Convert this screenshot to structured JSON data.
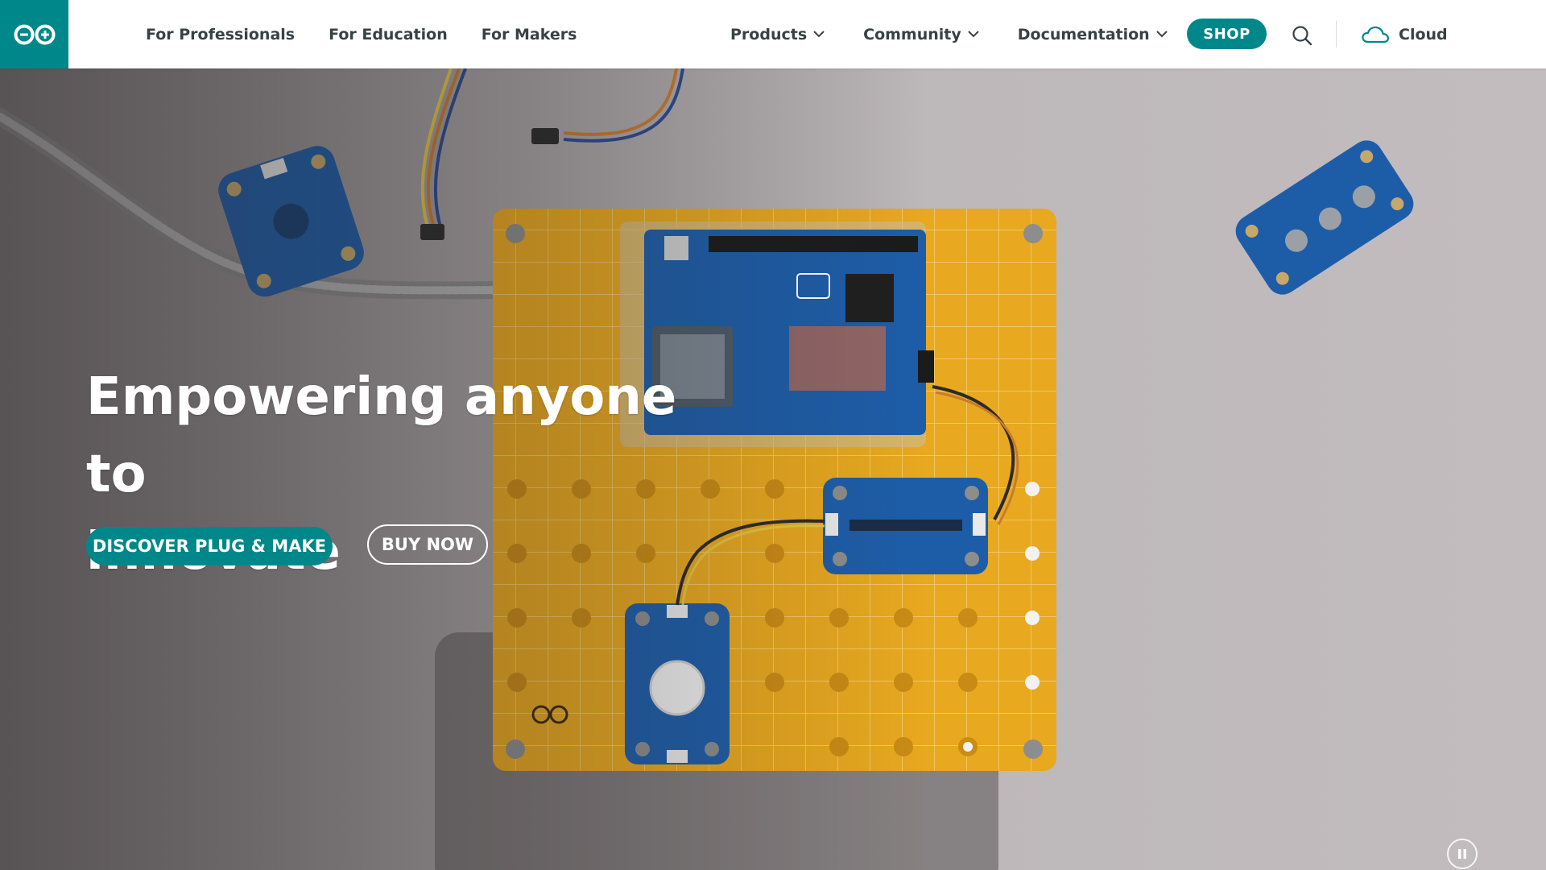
{
  "header": {
    "logo_icon": "arduino-infinity-logo-icon",
    "nav_left": [
      {
        "label": "For Professionals"
      },
      {
        "label": "For Education"
      },
      {
        "label": "For Makers"
      }
    ],
    "nav_right": [
      {
        "label": "Products",
        "icon": "chevron-down-icon"
      },
      {
        "label": "Community",
        "icon": "chevron-down-icon"
      },
      {
        "label": "Documentation",
        "icon": "chevron-down-icon"
      }
    ],
    "shop_label": "SHOP",
    "search_icon": "search-icon",
    "cloud_label": "Cloud",
    "cloud_icon": "cloud-icon"
  },
  "hero": {
    "title_line1": "Empowering anyone to",
    "title_line2": "innovate",
    "primary_cta": "DISCOVER PLUG & MAKE",
    "secondary_cta": "BUY NOW",
    "pause_icon": "pause-icon"
  },
  "colors": {
    "brand_teal": "#00878a",
    "nav_text": "#374146",
    "board_yellow": "#e8a81f",
    "module_blue": "#1d5da8"
  }
}
